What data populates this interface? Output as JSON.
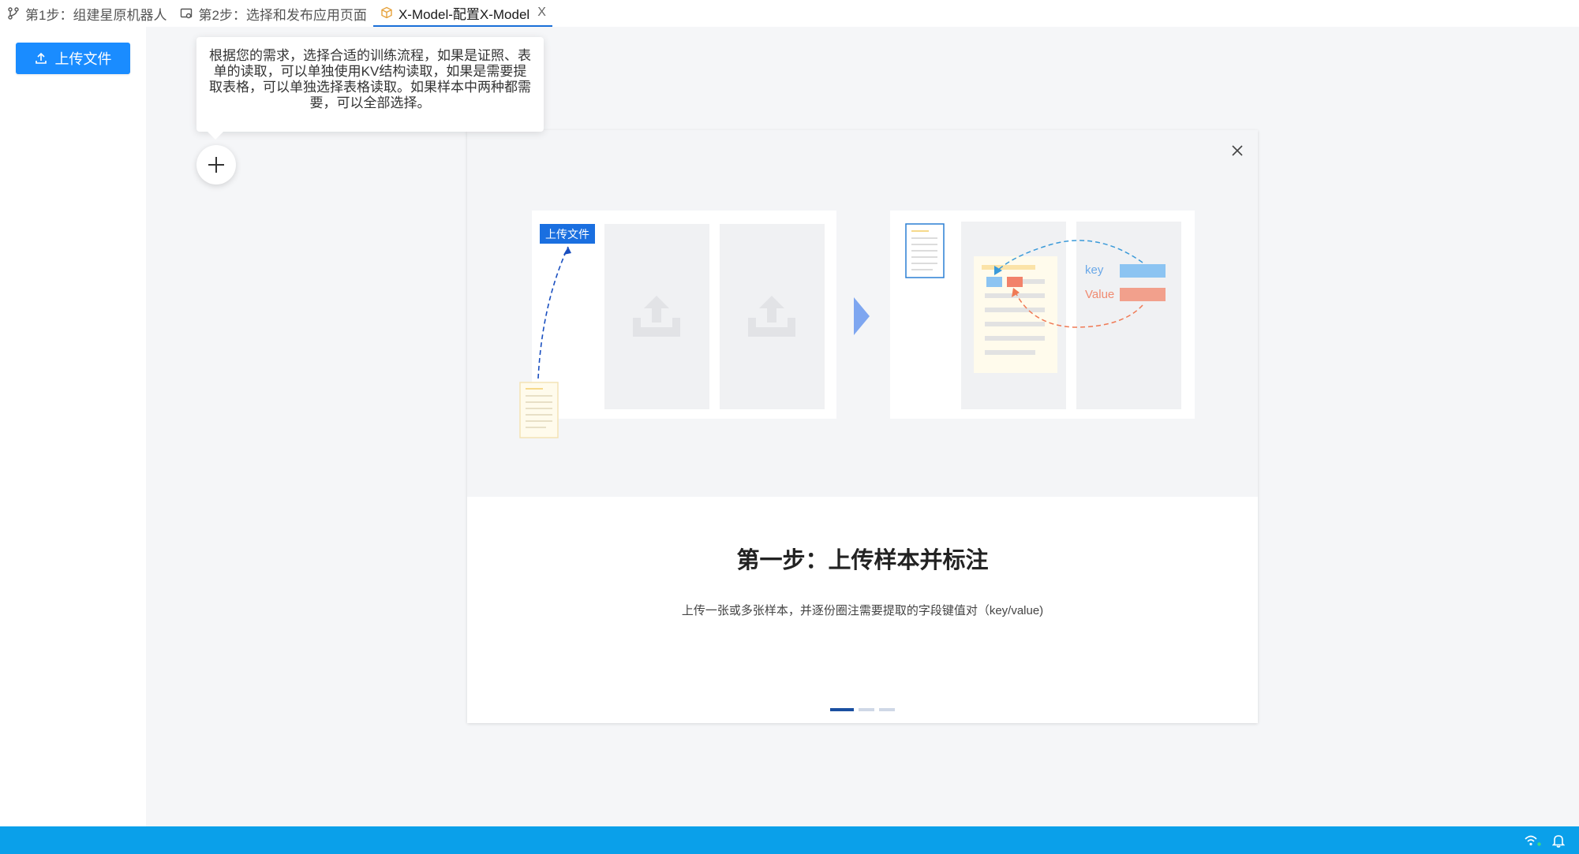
{
  "tabs": [
    {
      "label": "第1步：组建星原机器人",
      "icon": "flow-icon",
      "active": false
    },
    {
      "label": "第2步：选择和发布应用页面",
      "icon": "page-icon",
      "active": false
    },
    {
      "label": "X-Model-配置X-Model",
      "icon": "cube-icon",
      "active": true,
      "close": "X"
    }
  ],
  "sidebar": {
    "upload_label": "上传文件"
  },
  "tooltip": {
    "text": "根据您的需求，选择合适的训练流程，如果是证照、表单的读取，可以单独使用KV结构读取，如果是需要提取表格，可以单独选择表格读取。如果样本中两种都需要，可以全部选择。"
  },
  "modal": {
    "illustration": {
      "upload_tag": "上传文件",
      "key_label": "key",
      "value_label": "Value"
    },
    "title": "第一步：上传样本并标注",
    "description": "上传一张或多张样本，并逐份圈注需要提取的字段键值对（key/value)",
    "pagination": {
      "total": 3,
      "current": 1
    }
  },
  "colors": {
    "primary": "#1a8cff",
    "status_bar": "#0aa0ea",
    "key_blue": "#8cc4f2",
    "value_orange": "#f2a08c"
  }
}
